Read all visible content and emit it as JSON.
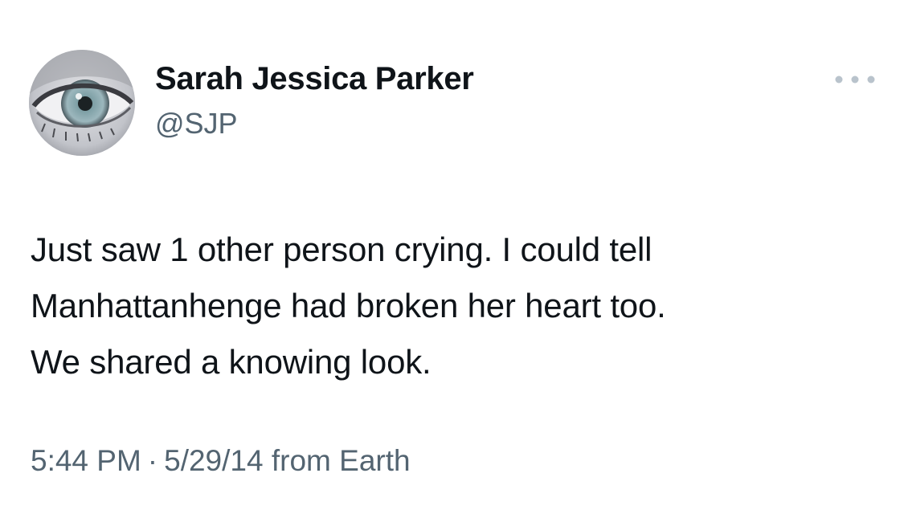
{
  "author": {
    "display_name": "Sarah Jessica Parker",
    "handle": "@SJP",
    "avatar_icon": "eye-closeup-avatar"
  },
  "tweet": {
    "text": "Just saw 1 other person crying. I could tell\nManhattanhenge had broken her heart too.\nWe shared a knowing look.",
    "time": "5:44 PM",
    "separator": "·",
    "date": "5/29/14",
    "source_prefix": "from",
    "source": "Earth"
  },
  "actions": {
    "more_icon": "more-options-icon"
  },
  "colors": {
    "text_primary": "#0f1419",
    "text_secondary": "#536471",
    "more_dots": "#b9c3cc",
    "background": "#ffffff"
  }
}
